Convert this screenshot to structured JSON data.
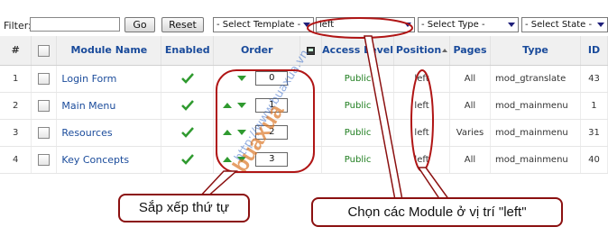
{
  "filter": {
    "label": "Filter:",
    "value": "",
    "go_label": "Go",
    "reset_label": "Reset"
  },
  "selects": {
    "template": "- Select Template -",
    "position": "left",
    "type": "- Select Type -",
    "state": "- Select State -"
  },
  "table": {
    "headers": {
      "num": "#",
      "name": "Module Name",
      "enabled": "Enabled",
      "order": "Order",
      "access": "Access Level",
      "position": "Position",
      "pages": "Pages",
      "type": "Type",
      "id": "ID"
    },
    "rows": [
      {
        "num": "1",
        "name": "Login Form",
        "order": "0",
        "access": "Public",
        "position": "left",
        "pages": "All",
        "type": "mod_gtranslate",
        "id": "43"
      },
      {
        "num": "2",
        "name": "Main Menu",
        "order": "1",
        "access": "Public",
        "position": "left",
        "pages": "All",
        "type": "mod_mainmenu",
        "id": "1"
      },
      {
        "num": "3",
        "name": "Resources",
        "order": "2",
        "access": "Public",
        "position": "left",
        "pages": "Varies",
        "type": "mod_mainmenu",
        "id": "31"
      },
      {
        "num": "4",
        "name": "Key Concepts",
        "order": "3",
        "access": "Public",
        "position": "left",
        "pages": "All",
        "type": "mod_mainmenu",
        "id": "40"
      }
    ]
  },
  "annotations": {
    "order_callout": "Sắp xếp thứ tự",
    "left_callout": "Chọn các Module ở vị trí \"left\""
  },
  "watermark": {
    "url": "http://www.buaxua.vn",
    "logo": "buaxua"
  },
  "colors": {
    "link": "#1a4b9b",
    "published": "#1e7d1e",
    "annotation": "#b01515"
  }
}
